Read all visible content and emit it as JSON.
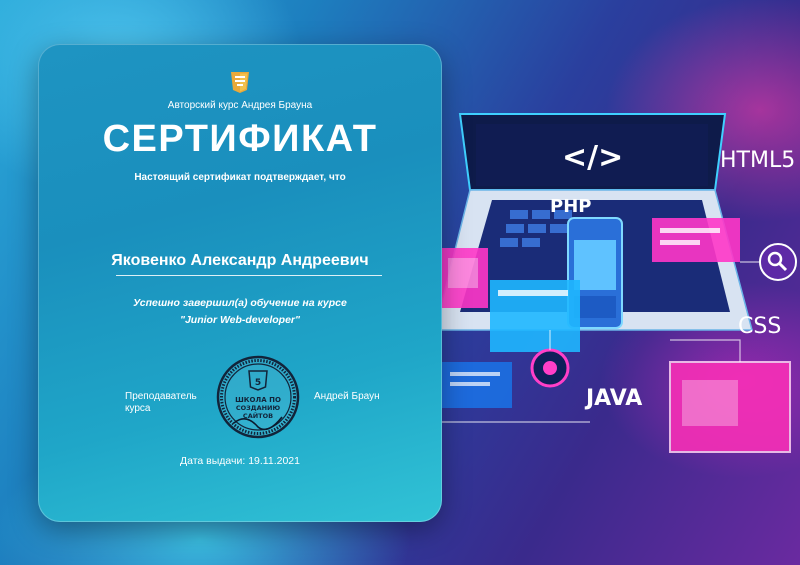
{
  "certificate": {
    "course_author": "Авторский курс Андрея Брауна",
    "title": "СЕРТИФИКАТ",
    "confirm_text": "Настоящий сертификат подтверждает, что",
    "recipient_name": "Яковенко Александр Андреевич",
    "completed_text": "Успешно завершил(а) обучение на курсе",
    "course_name": "\"Junior Web-developer\"",
    "teacher_label": "Преподаватель курса",
    "teacher_name": "Андрей Браун",
    "stamp_text": "ШКОЛА ПО СОЗДАНИЮ САЙТОВ",
    "issue_date": "Дата выдачи: 19.11.2021"
  },
  "illustration": {
    "code_symbol": "</>",
    "labels": {
      "html": "HTML5",
      "php": "PHP",
      "css": "CSS",
      "java": "JAVA"
    }
  },
  "colors": {
    "card": "#1e94c2",
    "accent_pink": "#ff2fb8",
    "accent_cyan": "#35e0ff"
  }
}
